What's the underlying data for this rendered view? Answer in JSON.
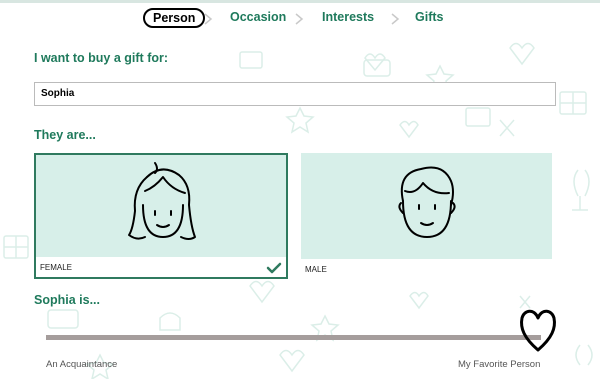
{
  "steps": [
    {
      "label": "Person",
      "active": true
    },
    {
      "label": "Occasion",
      "active": false
    },
    {
      "label": "Interests",
      "active": false
    },
    {
      "label": "Gifts",
      "active": false
    }
  ],
  "form": {
    "buy_for_label": "I want to buy a gift for:",
    "name_value": "Sophia",
    "they_are_label": "They are...",
    "is_label": "Sophia is..."
  },
  "genders": [
    {
      "label": "FEMALE",
      "selected": true
    },
    {
      "label": "MALE",
      "selected": false
    }
  ],
  "closeness": {
    "min_label": "An Acquaintance",
    "max_label": "My Favorite Person",
    "value": 1.0
  },
  "colors": {
    "accent": "#1f7a5c",
    "card_bg": "#d7efe9",
    "selected_border": "#2f7a5f",
    "track": "#a59d9c",
    "pattern": "#dbeee8"
  }
}
